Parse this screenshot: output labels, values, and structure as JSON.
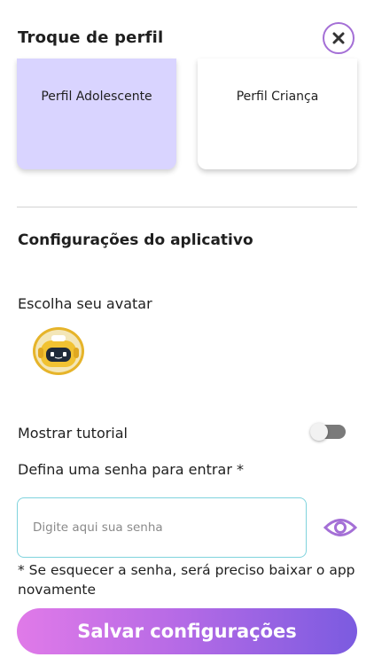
{
  "header": {
    "title": "Troque de perfil",
    "close_icon": "close-icon"
  },
  "profiles": [
    {
      "label": "Perfil Adolescente",
      "selected": true
    },
    {
      "label": "Perfil Criança",
      "selected": false
    }
  ],
  "settings": {
    "section_title": "Configurações do aplicativo",
    "avatar_label": "Escolha seu avatar",
    "avatar_icon": "robot-avatar-icon",
    "tutorial_label": "Mostrar tutorial",
    "tutorial_enabled": false,
    "password_label": "Defina uma senha para entrar *",
    "password_placeholder": "Digite aqui sua senha",
    "password_value": "",
    "eye_icon": "eye-icon",
    "note": "* Se esquecer a senha, será preciso baixar o app novamente"
  },
  "actions": {
    "save_label": "Salvar configurações"
  },
  "colors": {
    "accent_purple": "#a46fd6",
    "selected_card": "#d9d4ff",
    "input_border": "#7fd3dd",
    "button_gradient_start": "#e07ae8",
    "button_gradient_end": "#7b5be0",
    "avatar_ring": "#e6b42a"
  }
}
